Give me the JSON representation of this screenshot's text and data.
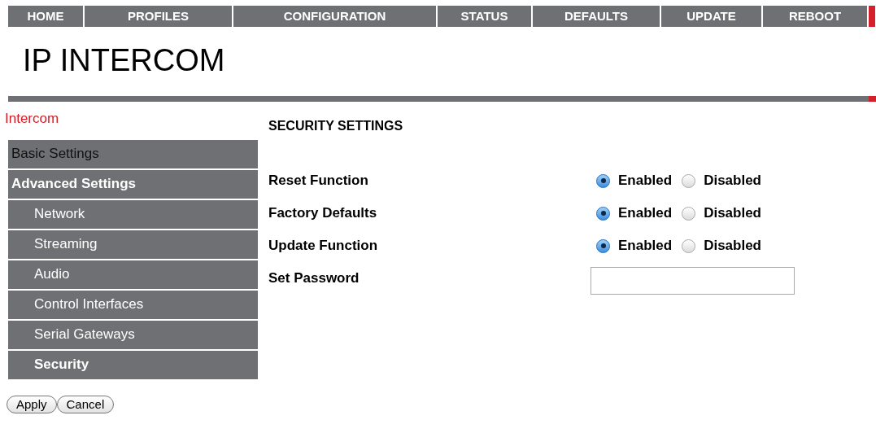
{
  "nav": [
    {
      "label": "HOME"
    },
    {
      "label": "PROFILES"
    },
    {
      "label": "CONFIGURATION"
    },
    {
      "label": "STATUS"
    },
    {
      "label": "DEFAULTS"
    },
    {
      "label": "UPDATE"
    },
    {
      "label": "REBOOT"
    }
  ],
  "title": "IP INTERCOM",
  "breadcrumb": "Intercom",
  "heading": "SECURITY SETTINGS",
  "sidebar": {
    "items": [
      {
        "label": "Basic Settings",
        "expanded": false,
        "selected": false
      },
      {
        "label": "Advanced Settings",
        "expanded": true,
        "selected": false,
        "children": [
          {
            "label": "Network",
            "selected": false
          },
          {
            "label": "Streaming",
            "selected": false
          },
          {
            "label": "Audio",
            "selected": false
          },
          {
            "label": "Control Interfaces",
            "selected": false
          },
          {
            "label": "Serial Gateways",
            "selected": false
          },
          {
            "label": "Security",
            "selected": true
          }
        ]
      }
    ]
  },
  "settings": [
    {
      "kind": "radio",
      "label": "Reset Function",
      "options": [
        {
          "label": "Enabled",
          "selected": true
        },
        {
          "label": "Disabled",
          "selected": false
        }
      ]
    },
    {
      "kind": "radio",
      "label": "Factory Defaults",
      "options": [
        {
          "label": "Enabled",
          "selected": true
        },
        {
          "label": "Disabled",
          "selected": false
        }
      ]
    },
    {
      "kind": "radio",
      "label": "Update Function",
      "options": [
        {
          "label": "Enabled",
          "selected": true
        },
        {
          "label": "Disabled",
          "selected": false
        }
      ]
    },
    {
      "kind": "password",
      "label": "Set Password"
    }
  ],
  "buttons": [
    {
      "label": "Apply"
    },
    {
      "label": "Cancel"
    }
  ]
}
